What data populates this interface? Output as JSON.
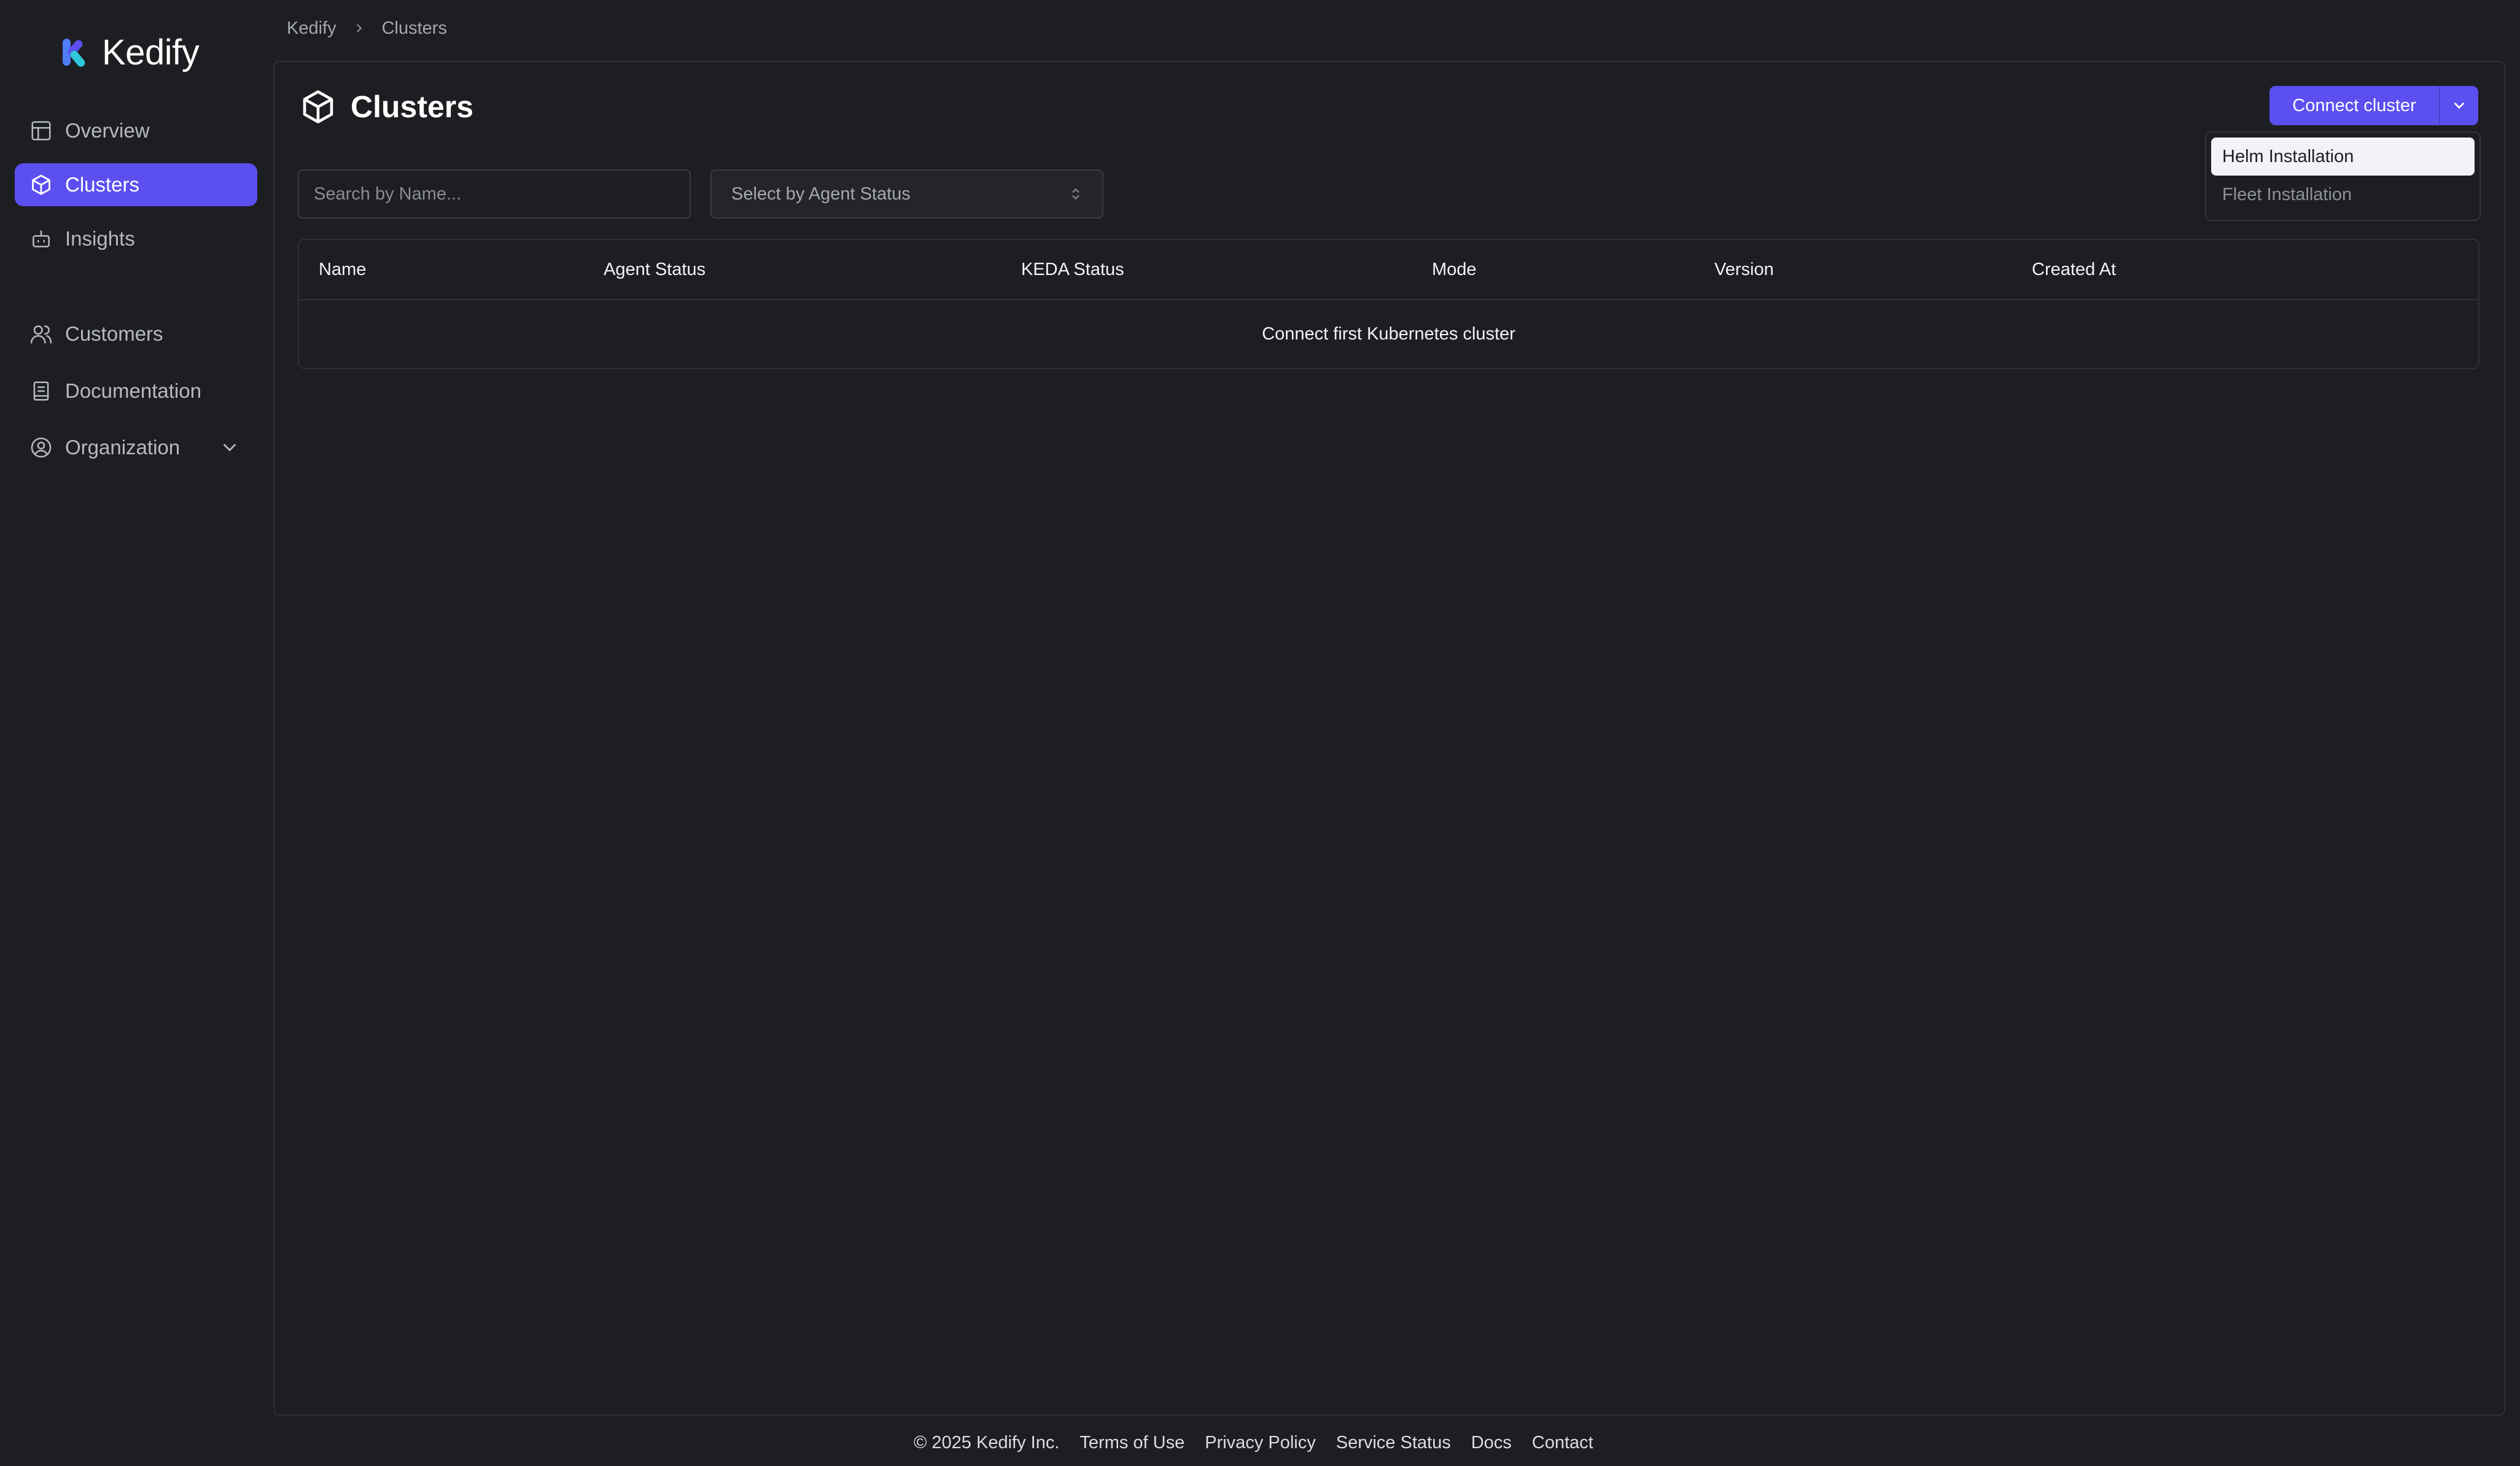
{
  "brand": {
    "name": "Kedify"
  },
  "sidebar": {
    "items": [
      {
        "label": "Overview",
        "icon": "layout-icon"
      },
      {
        "label": "Clusters",
        "icon": "cube-icon",
        "active": true
      },
      {
        "label": "Insights",
        "icon": "bot-icon"
      },
      {
        "label": "Customers",
        "icon": "users-icon"
      },
      {
        "label": "Documentation",
        "icon": "book-icon"
      },
      {
        "label": "Organization",
        "icon": "user-circle-icon"
      }
    ]
  },
  "breadcrumb": {
    "root": "Kedify",
    "current": "Clusters"
  },
  "page": {
    "title": "Clusters"
  },
  "toolbar": {
    "connect_label": "Connect cluster",
    "menu": [
      "Helm Installation",
      "Fleet Installation"
    ]
  },
  "filters": {
    "search_placeholder": "Search by Name...",
    "status_placeholder": "Select by Agent Status"
  },
  "table": {
    "columns": [
      "Name",
      "Agent Status",
      "KEDA Status",
      "Mode",
      "Version",
      "Created At"
    ],
    "empty_message": "Connect first Kubernetes cluster"
  },
  "footer": {
    "copyright": "© 2025 Kedify Inc.",
    "links": [
      "Terms of Use",
      "Privacy Policy",
      "Service Status",
      "Docs",
      "Contact"
    ]
  },
  "colors": {
    "background": "#1d1e22",
    "accent": "#5b4ff0",
    "border": "#2f3037"
  }
}
